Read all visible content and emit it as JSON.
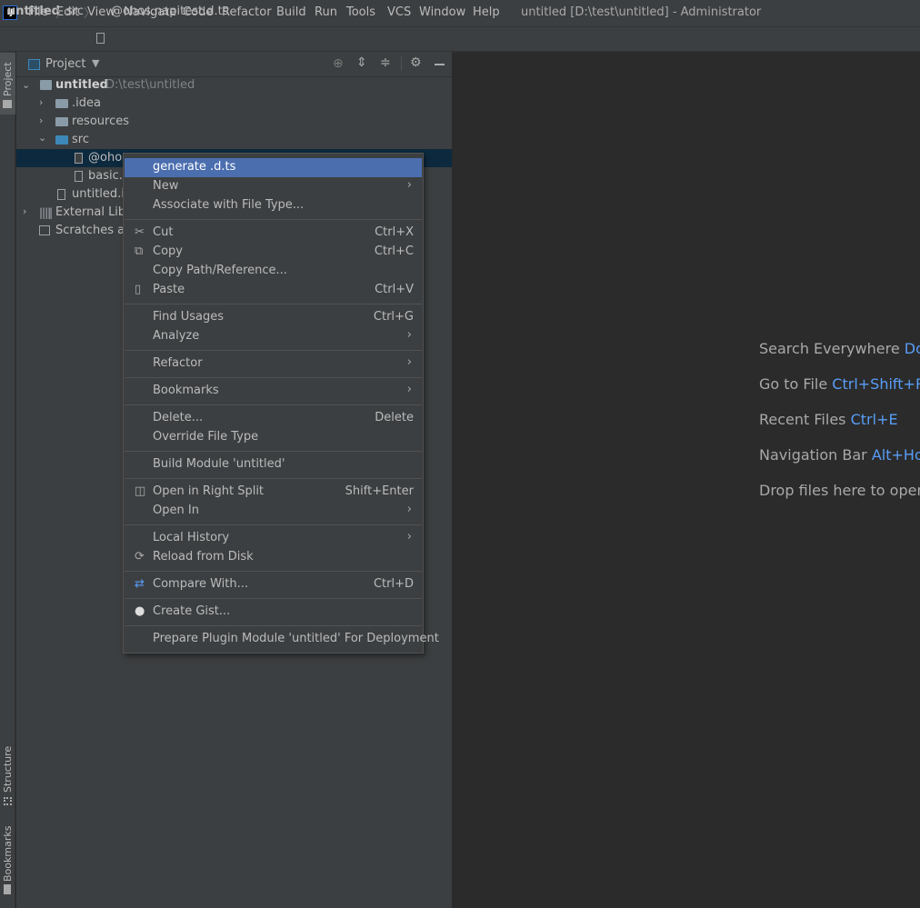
{
  "window_title": "untitled [D:\\test\\untitled] - Administrator",
  "app_logo": "IJ",
  "menubar": [
    "File",
    "Edit",
    "View",
    "Navigate",
    "Code",
    "Refactor",
    "Build",
    "Run",
    "Tools",
    "VCS",
    "Window",
    "Help"
  ],
  "breadcrumb": [
    "untitled",
    "src",
    "@ohos.napitest.d.ts"
  ],
  "left_stripe": {
    "project": "Project",
    "structure": "Structure",
    "bookmarks": "Bookmarks"
  },
  "panel": {
    "title": "Project"
  },
  "tree": {
    "root": "untitled",
    "root_path": "D:\\test\\untitled",
    "idea": ".idea",
    "resources": "resources",
    "src": "src",
    "file1": "@ohos",
    "file2": "basic.c",
    "iml": "untitled.im",
    "ext_libs": "External Libra",
    "scratches": "Scratches an"
  },
  "context_menu": {
    "generate": "generate .d.ts",
    "new": "New",
    "associate": "Associate with File Type...",
    "cut": "Cut",
    "cut_sc": "Ctrl+X",
    "copy": "Copy",
    "copy_sc": "Ctrl+C",
    "copy_path": "Copy Path/Reference...",
    "paste": "Paste",
    "paste_sc": "Ctrl+V",
    "find_usages": "Find Usages",
    "find_usages_sc": "Ctrl+G",
    "analyze": "Analyze",
    "refactor": "Refactor",
    "bookmarks": "Bookmarks",
    "delete": "Delete...",
    "delete_sc": "Delete",
    "override": "Override File Type",
    "build_module": "Build Module 'untitled'",
    "open_split": "Open in Right Split",
    "open_split_sc": "Shift+Enter",
    "open_in": "Open In",
    "local_history": "Local History",
    "reload": "Reload from Disk",
    "compare": "Compare With...",
    "compare_sc": "Ctrl+D",
    "gist": "Create Gist...",
    "prepare": "Prepare Plugin Module 'untitled' For Deployment"
  },
  "editor_hints": [
    {
      "label": "Search Everywhere",
      "key": "Dou"
    },
    {
      "label": "Go to File",
      "key": "Ctrl+Shift+R"
    },
    {
      "label": "Recent Files",
      "key": "Ctrl+E"
    },
    {
      "label": "Navigation Bar",
      "key": "Alt+Ho"
    },
    {
      "label": "Drop files here to open",
      "key": ""
    }
  ],
  "colors": {
    "accent": "#4b6eaf",
    "selection": "#0d293e",
    "key": "#589df6"
  }
}
